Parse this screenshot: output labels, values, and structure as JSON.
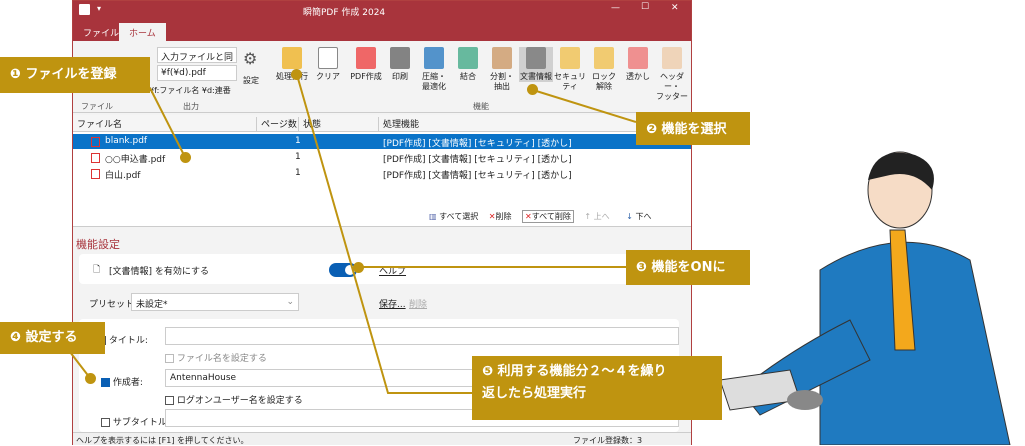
{
  "window": {
    "title": "瞬簡PDF 作成 2024",
    "tabs": [
      "ファイル",
      "ホーム"
    ]
  },
  "ribbon": {
    "output_folder": "入力ファイルと同じ",
    "output_name": "¥f(¥d).pdf",
    "hint": "¥f:ファイル名  ¥d:連番",
    "settings": "設定",
    "groups": {
      "file": "ファイル",
      "output": "出力",
      "function": "機能"
    },
    "run": "処理実行",
    "clear": "クリア",
    "functions": [
      "PDF作成",
      "印刷",
      "圧縮・\n最適化",
      "結合",
      "分割・\n抽出",
      "文書情報",
      "セキュリティ",
      "ロック\n解除",
      "透かし",
      "ヘッダー・\nフッター"
    ]
  },
  "list": {
    "headers": [
      "ファイル名",
      "ページ数",
      "状態",
      "処理機能"
    ],
    "rows": [
      {
        "name": "blank.pdf",
        "pages": "1",
        "status": "",
        "functions": "[PDF作成] [文書情報] [セキュリティ] [透かし]"
      },
      {
        "name": "○○申込書.pdf",
        "pages": "1",
        "status": "",
        "functions": "[PDF作成] [文書情報] [セキュリティ] [透かし]"
      },
      {
        "name": "白山.pdf",
        "pages": "1",
        "status": "",
        "functions": "[PDF作成] [文書情報] [セキュリティ] [透かし]"
      }
    ],
    "buttons": {
      "select_all": "すべて選択",
      "delete": "削除",
      "delete_all": "すべて削除",
      "up": "上へ",
      "down": "下へ"
    }
  },
  "settings": {
    "heading": "機能設定",
    "enable_label": "[文書情報] を有効にする",
    "help": "ヘルプ",
    "preset_label": "プリセット：",
    "preset_value": "未設定*",
    "save": "保存...",
    "remove": "削除",
    "title_label": "タイトル:",
    "title_value": "",
    "use_filename": "ファイル名を設定する",
    "author_label": "作成者:",
    "author_value": "AntennaHouse",
    "use_logon": "ログオンユーザー名を設定する",
    "subtitle_label": "サブタイトル:"
  },
  "status": {
    "help": "ヘルプを表示するには [F1] を押してください。",
    "count": "ファイル登録数：3"
  },
  "callouts": {
    "c1": "❶ ファイルを登録",
    "c2": "❷ 機能を選択",
    "c3": "❸ 機能をONに",
    "c4": "❹ 設定する",
    "c5a": "❺ 利用する機能分２～４を繰り",
    "c5b": "返したら処理実行"
  },
  "colors": {
    "accent": "#a8343c",
    "callout": "#bf9410",
    "selection": "#0a73c8"
  }
}
